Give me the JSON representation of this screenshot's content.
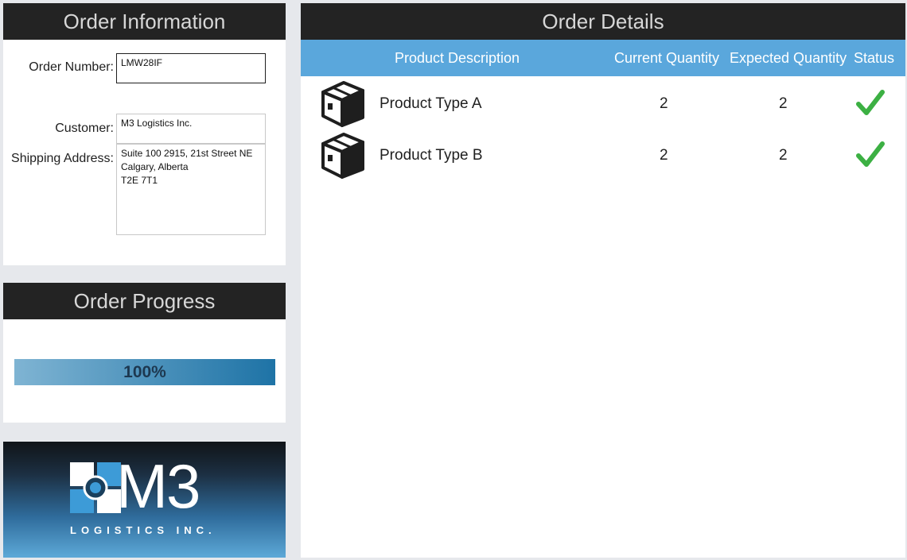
{
  "order_info": {
    "title": "Order Information",
    "order_number_label": "Order Number:",
    "order_number_value": "LMW28IF",
    "customer_label": "Customer:",
    "customer_value": "M3 Logistics Inc.",
    "shipping_address_label": "Shipping Address:",
    "shipping_address_value": "Suite 100 2915, 21st Street NE\nCalgary, Alberta\nT2E 7T1"
  },
  "order_progress": {
    "title": "Order Progress",
    "percent": 100,
    "label": "100%"
  },
  "logo": {
    "name": "M3",
    "tagline": "LOGISTICS INC."
  },
  "order_details": {
    "title": "Order Details",
    "columns": [
      "Product Description",
      "Current Quantity",
      "Expected Quantity",
      "Status"
    ],
    "rows": [
      {
        "icon": "box-icon",
        "description": "Product Type A",
        "current_quantity": "2",
        "expected_quantity": "2",
        "status": "check-icon"
      },
      {
        "icon": "box-icon",
        "description": "Product Type B",
        "current_quantity": "2",
        "expected_quantity": "2",
        "status": "check-icon"
      }
    ]
  },
  "colors": {
    "header_bg": "#232323",
    "table_header_bg": "#5aa7dc",
    "check_green": "#3cb043",
    "progress_start": "#7fb4d3",
    "progress_end": "#1e73a6"
  }
}
